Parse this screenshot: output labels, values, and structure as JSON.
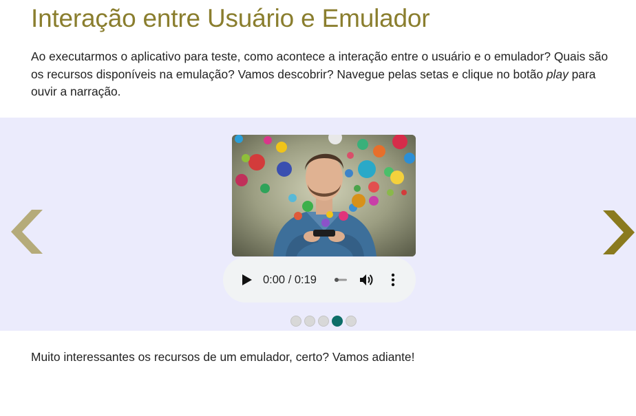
{
  "header": {
    "title": "Interação entre Usuário e Emulador"
  },
  "intro": {
    "text_before": "Ao executarmos o aplicativo para teste, como acontece a interação entre o usuário e o emulador? Quais são os recursos disponíveis na emulação? Vamos descobrir? Navegue pelas setas e clique no botão ",
    "emphasis": "play",
    "text_after": " para ouvir a narração."
  },
  "carousel": {
    "background": "#ebebfc",
    "arrow_color_left": "#b5ab7a",
    "arrow_color_right": "#8a7a1e",
    "prev_icon": "chevron-left-icon",
    "next_icon": "chevron-right-icon",
    "slide_image": "man-using-smartphone-with-app-icons",
    "audio": {
      "time_display": "0:00 / 0:19",
      "progress": 0
    },
    "dots_total": 5,
    "active_dot_index": 3,
    "active_dot_color": "#0e6e68"
  },
  "outro": {
    "text": "Muito interessantes os recursos de um emulador, certo? Vamos adiante!"
  }
}
